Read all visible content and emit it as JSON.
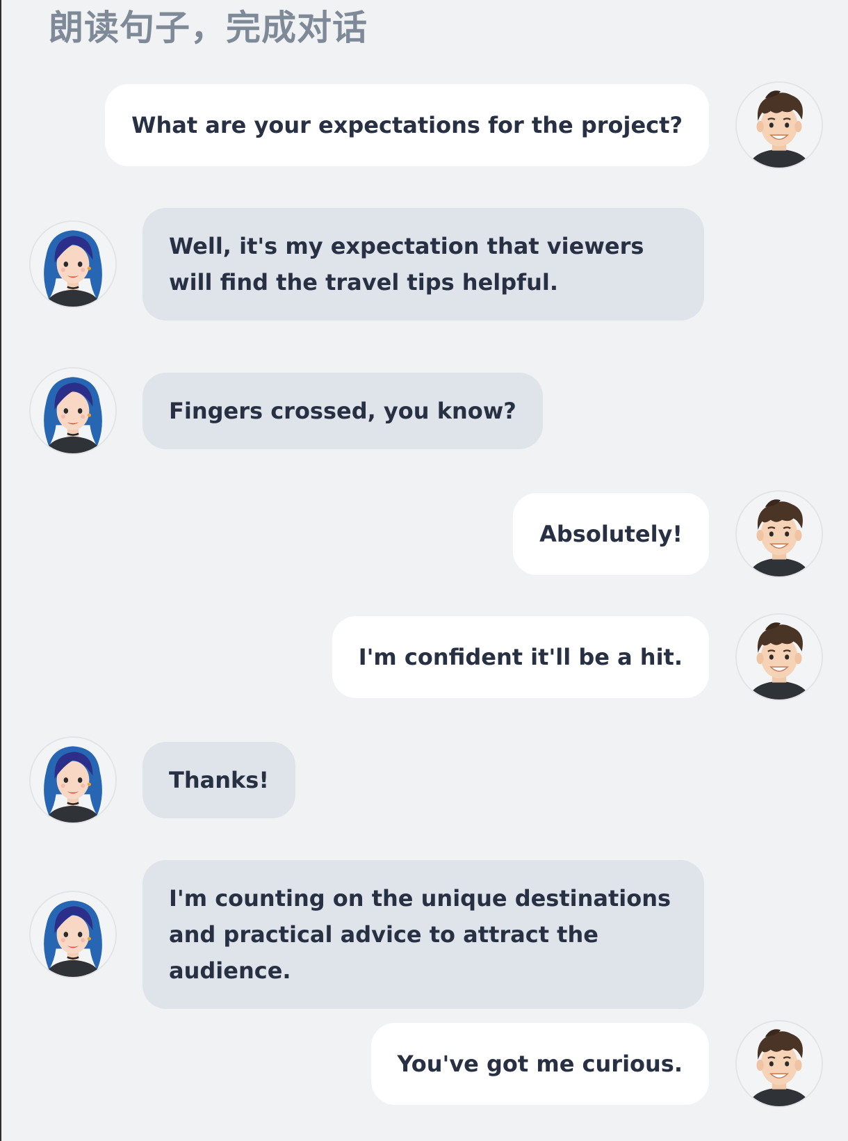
{
  "title": "朗读句子，完成对话",
  "messages": [
    {
      "speaker": "boy",
      "text": "What are your expectations for the project?"
    },
    {
      "speaker": "girl",
      "text": "Well, it's my expectation that viewers will find the travel tips helpful."
    },
    {
      "speaker": "girl",
      "text": "Fingers crossed, you know?"
    },
    {
      "speaker": "boy",
      "text": "Absolutely!"
    },
    {
      "speaker": "boy",
      "text": "I'm confident it'll be a hit."
    },
    {
      "speaker": "girl",
      "text": "Thanks!"
    },
    {
      "speaker": "girl",
      "text": "I'm counting on the unique destinations and practical advice to attract the audience."
    },
    {
      "speaker": "boy",
      "text": "You've got me curious."
    }
  ],
  "colors": {
    "background": "#f1f2f4",
    "title": "#7f8a99",
    "bubble_self": "#ffffff",
    "bubble_other": "#dfe3ea",
    "text": "#283043"
  },
  "icons": {
    "boy": "boy-avatar-icon",
    "girl": "girl-avatar-icon"
  }
}
